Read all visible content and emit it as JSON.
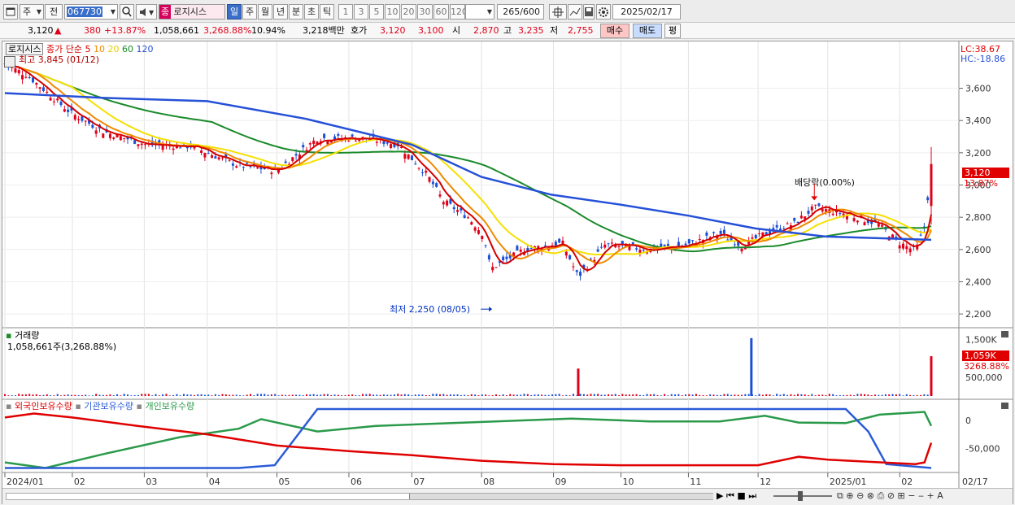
{
  "toolbar": {
    "period_label": "주",
    "prev_label": "전",
    "code": "067730",
    "stock_name": "로지시스",
    "periods": [
      "일",
      "주",
      "월",
      "년",
      "분",
      "초",
      "틱"
    ],
    "intervals": [
      "1",
      "3",
      "5",
      "10",
      "20",
      "30",
      "60",
      "120"
    ],
    "count": "265",
    "count_max": "/600",
    "date": "2025/02/17"
  },
  "pricebar": {
    "price": "3,120",
    "change_arrow": "▲",
    "change": "380",
    "change_pct": "+13.87%",
    "volume": "1,058,661",
    "volume_pct": "3,268.88%",
    "turnover": "10.94%",
    "amount": "3,218백만",
    "quote_label": "호가",
    "ask": "3,120",
    "bid": "3,100",
    "open_label": "시",
    "open": "2,870",
    "high_label": "고",
    "high": "3,235",
    "low_label": "저",
    "low": "2,755",
    "buy_label": "매수",
    "sell_label": "매도",
    "eval_label": "평"
  },
  "price_panel": {
    "legend_name": "로지시스",
    "legend_ma_label": "종가 단순",
    "ma_periods": [
      "5",
      "10",
      "20",
      "60",
      "120"
    ],
    "high_annot": "최고 3,845 (01/12)",
    "low_annot": "최저 2,250 (08/05)",
    "dividend_annot": "배당락(0.00%)",
    "lc": "LC:38.67",
    "hc": "HC:-18.86",
    "current_price": "3,120",
    "current_pct": "13.87%"
  },
  "volume_panel": {
    "title": "거래량",
    "value_text": "1,058,661주(3,268.88%)",
    "current": "1,059K",
    "current_pct": "3268.88%"
  },
  "holdings_panel": {
    "legend": [
      "외국인보유수량",
      "기관보유수량",
      "개인보유수량"
    ]
  },
  "colors": {
    "up": "#e0001a",
    "down": "#1a4fd6",
    "ma5": "#d40000",
    "ma10": "#f08a00",
    "ma20": "#f5e000",
    "ma60": "#1a8a2a",
    "ma120": "#2550d8",
    "foreign": "#e00000",
    "institution": "#2a5bd7",
    "individual": "#2a9a4a"
  },
  "chart_data": [
    {
      "type": "line",
      "title": "로지시스",
      "x_ticks": [
        "2024/01",
        "02",
        "03",
        "04",
        "05",
        "06",
        "07",
        "08",
        "09",
        "10",
        "11",
        "12",
        "2025/01",
        "02",
        "02/17"
      ],
      "y_ticks": [
        2200,
        2400,
        2600,
        2800,
        3000,
        3200,
        3400,
        3600
      ],
      "ylim": [
        2130,
        3870
      ],
      "series": [
        {
          "name": "종가",
          "x": [
            "2024-01-02",
            "2024-01-12",
            "2024-01-31",
            "2024-02-15",
            "2024-03-05",
            "2024-03-25",
            "2024-04-15",
            "2024-05-02",
            "2024-05-20",
            "2024-06-10",
            "2024-06-25",
            "2024-07-08",
            "2024-07-15",
            "2024-07-26",
            "2024-08-02",
            "2024-08-05",
            "2024-08-20",
            "2024-09-06",
            "2024-09-13",
            "2024-09-25",
            "2024-10-15",
            "2024-11-01",
            "2024-11-15",
            "2024-11-25",
            "2024-12-05",
            "2024-12-18",
            "2024-12-27",
            "2025-01-10",
            "2025-01-24",
            "2025-02-03",
            "2025-02-10",
            "2025-02-14",
            "2025-02-17"
          ],
          "y": [
            3750,
            3680,
            3450,
            3330,
            3250,
            3240,
            3120,
            3090,
            3290,
            3290,
            3250,
            3060,
            2900,
            2800,
            2690,
            2480,
            2600,
            2640,
            2430,
            2630,
            2600,
            2630,
            2700,
            2620,
            2700,
            2760,
            2860,
            2820,
            2760,
            2640,
            2590,
            2740,
            3120
          ]
        },
        {
          "name": "120",
          "x": [
            "2024-01-02",
            "2024-02-15",
            "2024-04-01",
            "2024-05-15",
            "2024-07-01",
            "2024-08-01",
            "2024-09-01",
            "2024-10-01",
            "2024-11-01",
            "2024-12-01",
            "2025-01-01",
            "2025-02-17"
          ],
          "y": [
            3570,
            3540,
            3520,
            3410,
            3250,
            3050,
            2940,
            2880,
            2810,
            2730,
            2680,
            2660
          ]
        }
      ]
    },
    {
      "type": "bar",
      "title": "거래량",
      "y_ticks": [
        "1,500K",
        "500,000"
      ],
      "highlights": [
        {
          "x": "2024-09-13",
          "value": 730000
        },
        {
          "x": "2024-11-29",
          "value": 1540000
        },
        {
          "x": "2025-02-17",
          "value": 1058661
        }
      ]
    },
    {
      "type": "line",
      "title": "보유수량",
      "y_ticks": [
        "0",
        "-50,000"
      ],
      "series": [
        {
          "name": "외국인보유수량",
          "trend": "falling from near 0 to about -90,000, rising to about -40,000 on 02/17"
        },
        {
          "name": "기관보유수량",
          "trend": "flat low until 05, jump high until 2025/01, drop to low"
        },
        {
          "name": "개인보유수량",
          "trend": "rising from about -90,000 to about 0"
        }
      ]
    }
  ]
}
